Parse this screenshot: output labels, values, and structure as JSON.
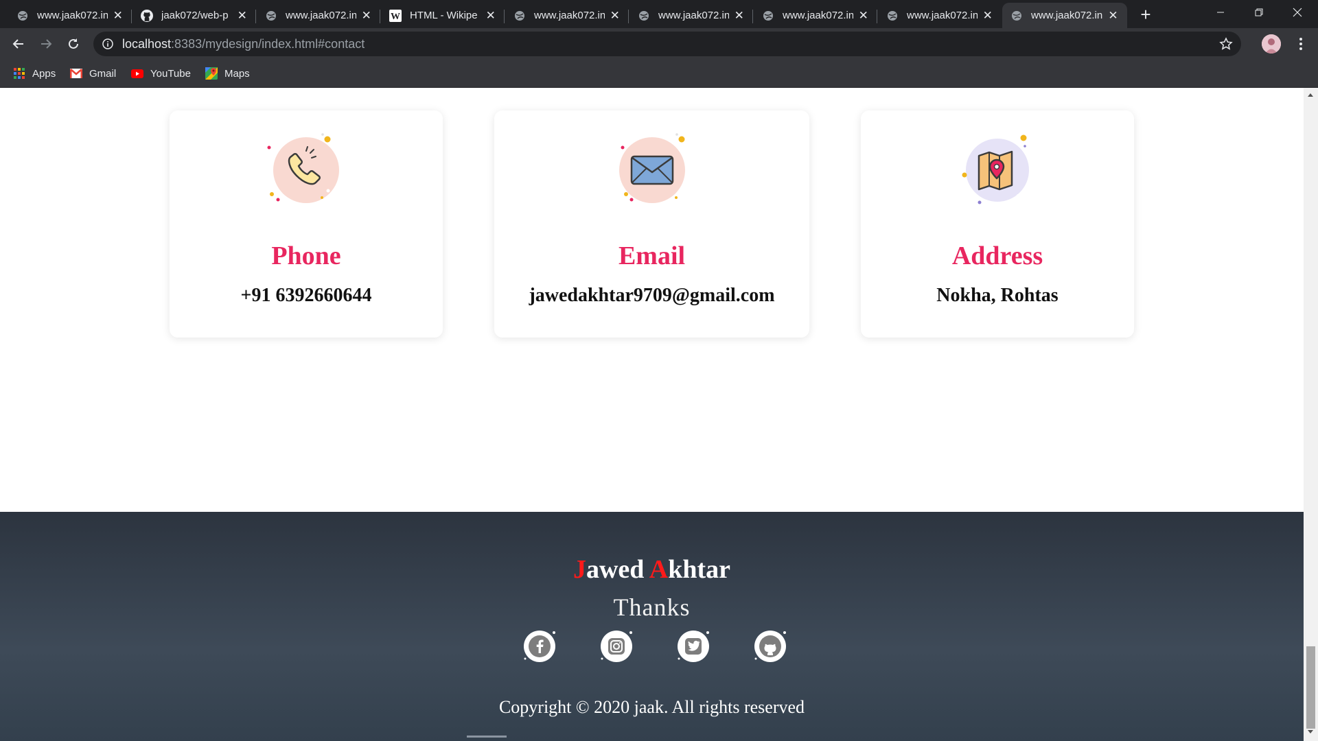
{
  "browser": {
    "tabs": [
      {
        "title": "www.jaak072.in",
        "icon": "globe-icon"
      },
      {
        "title": "jaak072/web-p",
        "icon": "github-icon"
      },
      {
        "title": "www.jaak072.in",
        "icon": "globe-icon"
      },
      {
        "title": "HTML - Wikipe",
        "icon": "wikipedia-icon"
      },
      {
        "title": "www.jaak072.in",
        "icon": "globe-icon"
      },
      {
        "title": "www.jaak072.in",
        "icon": "globe-icon"
      },
      {
        "title": "www.jaak072.in",
        "icon": "globe-icon"
      },
      {
        "title": "www.jaak072.in",
        "icon": "globe-icon"
      },
      {
        "title": "www.jaak072.in",
        "icon": "globe-icon",
        "active": true
      }
    ],
    "close_glyph": "✕",
    "new_tab_glyph": "+",
    "url": {
      "host": "localhost",
      "rest": ":8383/mydesign/index.html#contact"
    },
    "bookmarks": [
      {
        "label": "Apps",
        "icon": "apps-grid-icon"
      },
      {
        "label": "Gmail",
        "icon": "gmail-icon"
      },
      {
        "label": "YouTube",
        "icon": "youtube-icon"
      },
      {
        "label": "Maps",
        "icon": "maps-icon"
      }
    ]
  },
  "contact": {
    "cards": [
      {
        "title": "Phone",
        "value": "+91 6392660644",
        "icon": "phone-icon"
      },
      {
        "title": "Email",
        "value": "jawedakhtar9709@gmail.com",
        "icon": "envelope-icon"
      },
      {
        "title": "Address",
        "value": "Nokha, Rohtas",
        "icon": "map-pin-icon"
      }
    ],
    "accent_color": "#e8265f"
  },
  "footer": {
    "name": {
      "first_initial": "J",
      "first_rest": "awed",
      "last_initial": "A",
      "last_rest": "khtar"
    },
    "thanks": "Thanks",
    "socials": [
      "facebook-icon",
      "instagram-icon",
      "twitter-icon",
      "github-icon"
    ],
    "copyright": "Copyright © 2020 jaak. All rights reserved",
    "initial_color": "#ff1a1a"
  }
}
